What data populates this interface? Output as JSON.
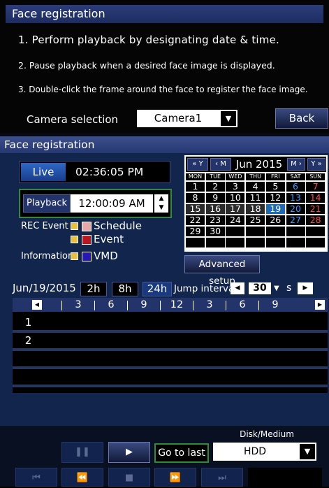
{
  "top_panel": {
    "title": "Face registration",
    "instructions": [
      "1. Perform playback by designating date & time.",
      "2. Pause playback when a desired face image is displayed.",
      "3. Double-click the frame around the face to register the face image."
    ],
    "camera_label": "Camera selection",
    "camera_value": "Camera1",
    "back_label": "Back"
  },
  "panel": {
    "title": "Face registration",
    "live_label": "Live",
    "live_time": "02:36:05 PM",
    "playback_label": "Playback",
    "playback_time": "12:00:09 AM",
    "rec_event_label": "REC Event",
    "information_label": "Information",
    "legend": [
      {
        "label": "Schedule",
        "color": "#e8a8a8"
      },
      {
        "label": "Event",
        "color": "#b8181e"
      },
      {
        "label": "VMD",
        "color": "#2418b0"
      }
    ],
    "advanced_label": "Advanced setup"
  },
  "calendar": {
    "year_prev": "« Y",
    "month_prev": "‹ M",
    "month_label": "Jun 2015",
    "month_next": "M ›",
    "year_next": "Y »",
    "weekdays": [
      "MON",
      "TUE",
      "WED",
      "THU",
      "FRI",
      "SAT",
      "SUN"
    ],
    "weeks": [
      [
        "1",
        "2",
        "3",
        "4",
        "5",
        "6",
        "7"
      ],
      [
        "8",
        "9",
        "10",
        "11",
        "12",
        "13",
        "14"
      ],
      [
        "15",
        "16",
        "17",
        "18",
        "19",
        "20",
        "21"
      ],
      [
        "22",
        "23",
        "24",
        "25",
        "26",
        "27",
        "28"
      ],
      [
        "29",
        "30",
        "",
        "",
        "",
        "",
        ""
      ],
      [
        "",
        "",
        "",
        "",
        "",
        "",
        ""
      ]
    ],
    "recorded_days": [
      "15",
      "16",
      "17",
      "18"
    ],
    "selected_day": "19"
  },
  "timeline": {
    "date": "Jun/19/2015",
    "ranges": [
      "2h",
      "8h",
      "24h"
    ],
    "active_range": "24h",
    "jump_label": "Jump interval",
    "jump_value": "30",
    "jump_unit": "s",
    "hours": [
      "3",
      "6",
      "9",
      "12",
      "3",
      "6",
      "9"
    ],
    "channels": [
      "1",
      "2",
      "",
      ""
    ]
  },
  "controls": {
    "go_last_label": "Go to last",
    "disk_label": "Disk/Medium",
    "disk_value": "HDD"
  },
  "colors": {
    "title_bar": "#263870",
    "accent_green": "#2f8a3a",
    "sat": "#3c9cff",
    "sun": "#ff4a4a"
  }
}
